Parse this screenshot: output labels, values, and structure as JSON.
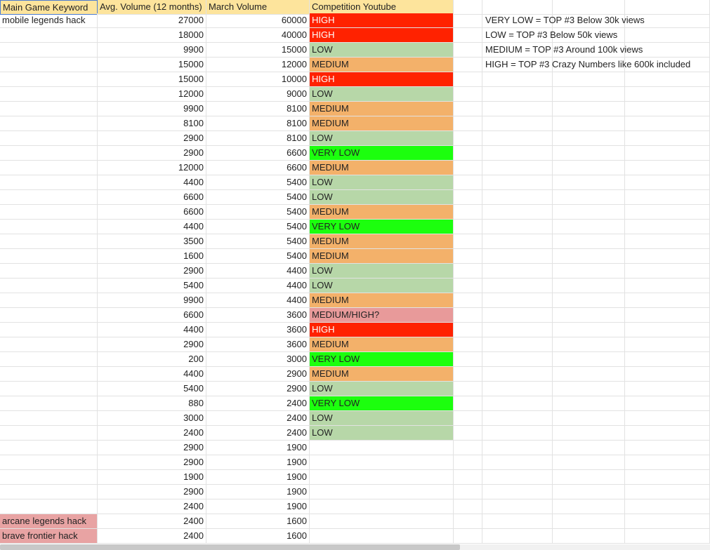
{
  "header": {
    "col_a": "Main Game Keyword",
    "col_b": "Avg. Volume (12 months)",
    "col_c": "March Volume",
    "col_d": "Competition Youtube"
  },
  "legend": [
    "VERY LOW = TOP #3 Below 30k views",
    "LOW = TOP #3 Below 50k views",
    "MEDIUM = TOP #3 Around 100k views",
    "HIGH = TOP #3 Crazy Numbers like 600k included"
  ],
  "rows": [
    {
      "keyword": "mobile legends hack",
      "avg": "27000",
      "march": "60000",
      "competition": "HIGH"
    },
    {
      "keyword": "",
      "avg": "18000",
      "march": "40000",
      "competition": "HIGH"
    },
    {
      "keyword": "",
      "avg": "9900",
      "march": "15000",
      "competition": "LOW"
    },
    {
      "keyword": "",
      "avg": "15000",
      "march": "12000",
      "competition": "MEDIUM"
    },
    {
      "keyword": "",
      "avg": "15000",
      "march": "10000",
      "competition": "HIGH"
    },
    {
      "keyword": "",
      "avg": "12000",
      "march": "9000",
      "competition": "LOW"
    },
    {
      "keyword": "",
      "avg": "9900",
      "march": "8100",
      "competition": "MEDIUM"
    },
    {
      "keyword": "",
      "avg": "8100",
      "march": "8100",
      "competition": "MEDIUM"
    },
    {
      "keyword": "",
      "avg": "2900",
      "march": "8100",
      "competition": "LOW"
    },
    {
      "keyword": "",
      "avg": "2900",
      "march": "6600",
      "competition": "VERY LOW"
    },
    {
      "keyword": "",
      "avg": "12000",
      "march": "6600",
      "competition": "MEDIUM"
    },
    {
      "keyword": "",
      "avg": "4400",
      "march": "5400",
      "competition": "LOW"
    },
    {
      "keyword": "",
      "avg": "6600",
      "march": "5400",
      "competition": "LOW"
    },
    {
      "keyword": "",
      "avg": "6600",
      "march": "5400",
      "competition": "MEDIUM"
    },
    {
      "keyword": "",
      "avg": "4400",
      "march": "5400",
      "competition": "VERY LOW"
    },
    {
      "keyword": "",
      "avg": "3500",
      "march": "5400",
      "competition": "MEDIUM"
    },
    {
      "keyword": "",
      "avg": "1600",
      "march": "5400",
      "competition": "MEDIUM"
    },
    {
      "keyword": "",
      "avg": "2900",
      "march": "4400",
      "competition": "LOW"
    },
    {
      "keyword": "",
      "avg": "5400",
      "march": "4400",
      "competition": "LOW"
    },
    {
      "keyword": "",
      "avg": "9900",
      "march": "4400",
      "competition": "MEDIUM"
    },
    {
      "keyword": "",
      "avg": "6600",
      "march": "3600",
      "competition": "MEDIUM/HIGH?"
    },
    {
      "keyword": "",
      "avg": "4400",
      "march": "3600",
      "competition": "HIGH"
    },
    {
      "keyword": "",
      "avg": "2900",
      "march": "3600",
      "competition": "MEDIUM"
    },
    {
      "keyword": "",
      "avg": "200",
      "march": "3000",
      "competition": "VERY LOW"
    },
    {
      "keyword": "",
      "avg": "4400",
      "march": "2900",
      "competition": "MEDIUM"
    },
    {
      "keyword": "",
      "avg": "5400",
      "march": "2900",
      "competition": "LOW"
    },
    {
      "keyword": "",
      "avg": "880",
      "march": "2400",
      "competition": "VERY LOW"
    },
    {
      "keyword": "",
      "avg": "3000",
      "march": "2400",
      "competition": "LOW"
    },
    {
      "keyword": "",
      "avg": "2400",
      "march": "2400",
      "competition": "LOW"
    },
    {
      "keyword": "",
      "avg": "2900",
      "march": "1900",
      "competition": ""
    },
    {
      "keyword": "",
      "avg": "2900",
      "march": "1900",
      "competition": ""
    },
    {
      "keyword": "",
      "avg": "1900",
      "march": "1900",
      "competition": ""
    },
    {
      "keyword": "",
      "avg": "2900",
      "march": "1900",
      "competition": ""
    },
    {
      "keyword": "",
      "avg": "2400",
      "march": "1900",
      "competition": ""
    },
    {
      "keyword": "arcane legends hack",
      "avg": "2400",
      "march": "1600",
      "competition": "",
      "highlight": true
    },
    {
      "keyword": "brave frontier hack",
      "avg": "2400",
      "march": "1600",
      "competition": "",
      "highlight": true
    }
  ],
  "colors": {
    "header": "#fde49c",
    "high": "#ff2200",
    "medium": "#f3b16a",
    "low": "#b7d7a8",
    "very_low": "#1cff0e",
    "medium_high": "#e89a9a",
    "keyword_highlight": "#e8a3a3"
  }
}
